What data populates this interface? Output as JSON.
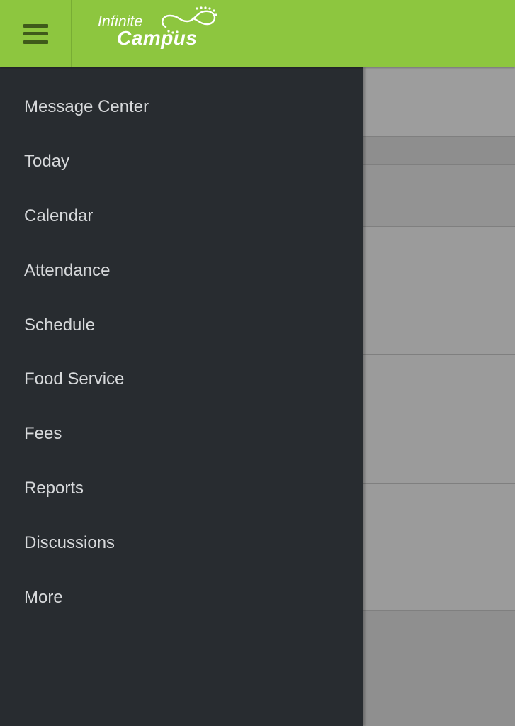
{
  "app": {
    "logo_top": "Infinite",
    "logo_bottom": "Campus",
    "brand_color": "#8dc63f",
    "drawer_color": "#282c30"
  },
  "header": {
    "menu_icon": "hamburger-menu-icon"
  },
  "drawer": {
    "items": [
      {
        "label": "Message Center"
      },
      {
        "label": "Today"
      },
      {
        "label": "Calendar"
      },
      {
        "label": "Attendance"
      },
      {
        "label": "Schedule"
      },
      {
        "label": "Food Service"
      },
      {
        "label": "Fees"
      },
      {
        "label": "Reports"
      },
      {
        "label": "Discussions"
      },
      {
        "label": "More"
      }
    ]
  }
}
